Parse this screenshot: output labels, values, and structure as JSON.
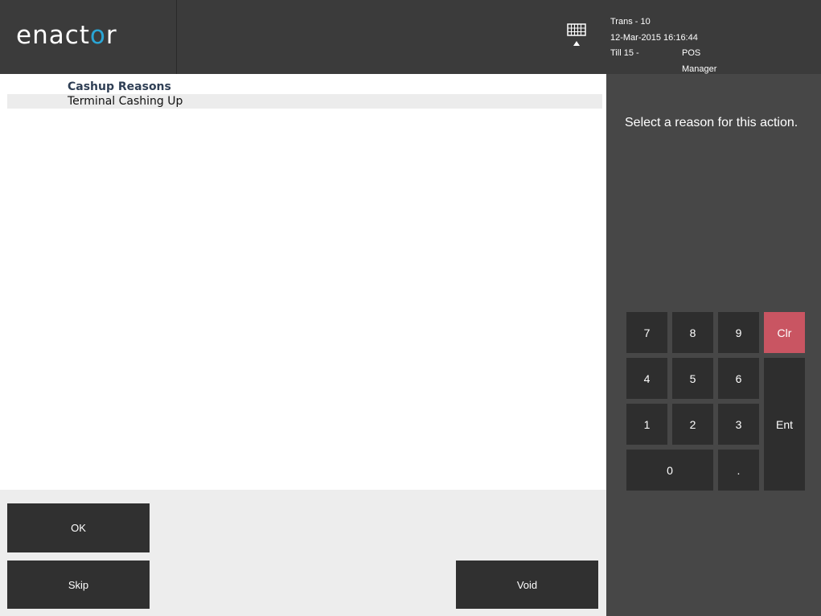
{
  "header": {
    "logo_text": "enactor",
    "logo_accent_color": "#2aa6d6",
    "trans": "Trans - 10",
    "datetime": "12-Mar-2015 16:16:44",
    "till": "Till 15 -",
    "user": "POS Manager",
    "keyboard_icon": "keyboard-icon"
  },
  "list": {
    "title": "Cashup Reasons",
    "items": [
      "Terminal Cashing Up"
    ]
  },
  "buttons": {
    "ok": "OK",
    "skip": "Skip",
    "void": "Void"
  },
  "panel": {
    "prompt": "Select a reason for this action."
  },
  "keypad": {
    "k7": "7",
    "k8": "8",
    "k9": "9",
    "clr": "Clr",
    "k4": "4",
    "k5": "5",
    "k6": "6",
    "k1": "1",
    "k2": "2",
    "k3": "3",
    "ent": "Ent",
    "k0": "0",
    "dot": ".",
    "clr_color": "#c95562"
  }
}
